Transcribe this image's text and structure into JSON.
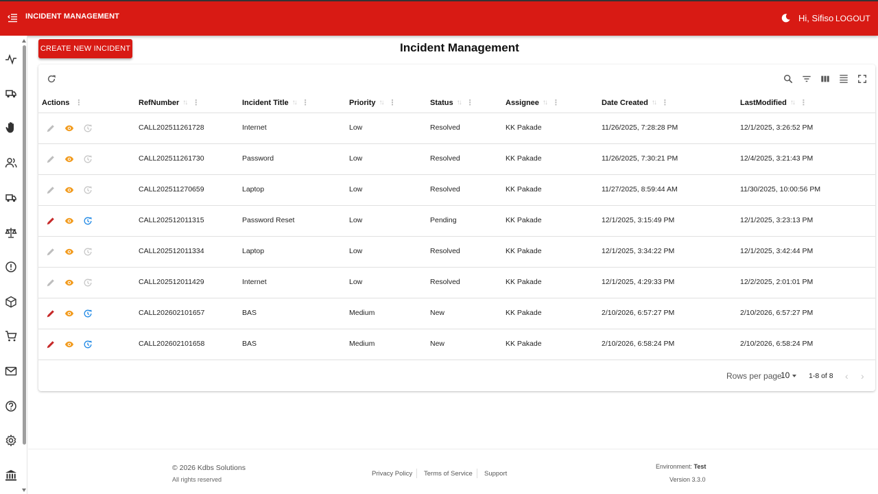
{
  "header": {
    "app_title": "INCIDENT MANAGEMENT",
    "greeting": "Hi, Sifiso",
    "logout_label": "LOGOUT",
    "brand_color": "#d81a14"
  },
  "sidebar": {
    "items": [
      {
        "icon": "activity-icon"
      },
      {
        "icon": "truck-icon"
      },
      {
        "icon": "hand-icon"
      },
      {
        "icon": "users-icon"
      },
      {
        "icon": "truck-icon"
      },
      {
        "icon": "scale-icon"
      },
      {
        "icon": "alert-circle-icon"
      },
      {
        "icon": "box-icon"
      },
      {
        "icon": "cart-icon"
      },
      {
        "icon": "mail-icon"
      },
      {
        "icon": "help-circle-icon"
      },
      {
        "icon": "settings-icon"
      },
      {
        "icon": "bank-icon"
      }
    ]
  },
  "page": {
    "create_button": "CREATE NEW INCIDENT",
    "title": "Incident Management"
  },
  "table": {
    "columns": [
      "Actions",
      "RefNumber",
      "Incident Title",
      "Priority",
      "Status",
      "Assignee",
      "Date Created",
      "LastModified"
    ],
    "rows": [
      {
        "ref": "CALL202511261728",
        "title": "Internet",
        "priority": "Low",
        "status": "Resolved",
        "assignee": "KK Pakade",
        "created": "11/26/2025, 7:28:28 PM",
        "modified": "12/1/2025, 3:26:52 PM",
        "editable": false
      },
      {
        "ref": "CALL202511261730",
        "title": "Password",
        "priority": "Low",
        "status": "Resolved",
        "assignee": "KK Pakade",
        "created": "11/26/2025, 7:30:21 PM",
        "modified": "12/4/2025, 3:21:43 PM",
        "editable": false
      },
      {
        "ref": "CALL202511270659",
        "title": "Laptop",
        "priority": "Low",
        "status": "Resolved",
        "assignee": "KK Pakade",
        "created": "11/27/2025, 8:59:44 AM",
        "modified": "11/30/2025, 10:00:56 PM",
        "editable": false
      },
      {
        "ref": "CALL202512011315",
        "title": "Password Reset",
        "priority": "Low",
        "status": "Pending",
        "assignee": "KK Pakade",
        "created": "12/1/2025, 3:15:49 PM",
        "modified": "12/1/2025, 3:23:13 PM",
        "editable": true
      },
      {
        "ref": "CALL202512011334",
        "title": "Laptop",
        "priority": "Low",
        "status": "Resolved",
        "assignee": "KK Pakade",
        "created": "12/1/2025, 3:34:22 PM",
        "modified": "12/1/2025, 3:42:44 PM",
        "editable": false
      },
      {
        "ref": "CALL202512011429",
        "title": "Internet",
        "priority": "Low",
        "status": "Resolved",
        "assignee": "KK Pakade",
        "created": "12/1/2025, 4:29:33 PM",
        "modified": "12/2/2025, 2:01:01 PM",
        "editable": false
      },
      {
        "ref": "CALL202602101657",
        "title": "BAS",
        "priority": "Medium",
        "status": "New",
        "assignee": "KK Pakade",
        "created": "2/10/2026, 6:57:27 PM",
        "modified": "2/10/2026, 6:57:27 PM",
        "editable": true
      },
      {
        "ref": "CALL202602101658",
        "title": "BAS",
        "priority": "Medium",
        "status": "New",
        "assignee": "KK Pakade",
        "created": "2/10/2026, 6:58:24 PM",
        "modified": "2/10/2026, 6:58:24 PM",
        "editable": true
      }
    ]
  },
  "pagination": {
    "rows_per_page_label": "Rows per page",
    "rows_per_page": "10",
    "range": "1-8 of 8"
  },
  "footer": {
    "copyright": "© 2026 Kdbs Solutions",
    "rights": "All rights reserved",
    "links": [
      "Privacy Policy",
      "Terms of Service",
      "Support"
    ],
    "environment_label": "Environment:",
    "environment_value": "Test",
    "version": "Version 3.3.0"
  },
  "colors": {
    "edit_active": "#c62828",
    "edit_disabled": "#bdbdbd",
    "view": "#f29b1e",
    "history_active": "#1e88e5",
    "history_disabled": "#c7c7c7"
  }
}
